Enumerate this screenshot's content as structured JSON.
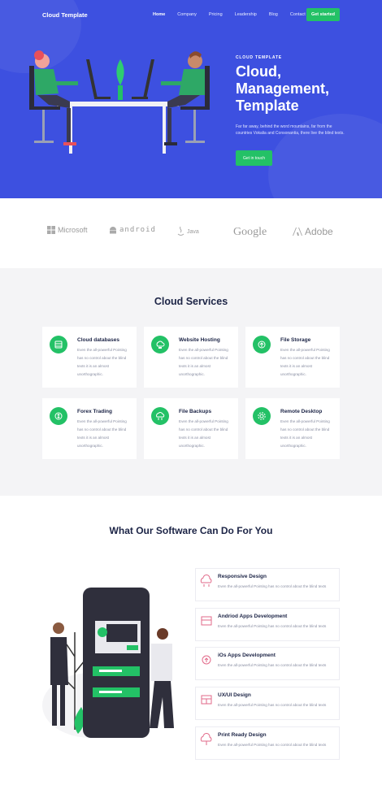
{
  "nav": {
    "logo": "Cloud Template",
    "items": [
      "Home",
      "Company",
      "Pricing",
      "Leadership",
      "Blog",
      "Contact"
    ],
    "cta": "Get started"
  },
  "hero": {
    "kicker": "CLOUD TEMPLATE",
    "title_line1": "Cloud,",
    "title_line2": "Management,",
    "title_line3": "Template",
    "text": "Far far away, behind the word mountains, far from the countries Vokalia and Consonantia, there live the blind texts.",
    "button": "Get in touch"
  },
  "brands": [
    "Microsoft",
    "android",
    "Java",
    "Google",
    "Adobe"
  ],
  "services": {
    "title": "Cloud Services",
    "desc": "Even the all-powerful Pointing has no control about the blind texts it is an almost unorthographic.",
    "items": [
      {
        "title": "Cloud databases",
        "icon": "database-icon"
      },
      {
        "title": "Website Hosting",
        "icon": "hosting-icon"
      },
      {
        "title": "File Storage",
        "icon": "storage-icon"
      },
      {
        "title": "Forex Trading",
        "icon": "trading-icon"
      },
      {
        "title": "File Backups",
        "icon": "backup-icon"
      },
      {
        "title": "Remote Desktop",
        "icon": "gear-icon"
      }
    ]
  },
  "features": {
    "title": "What Our Software Can Do For You",
    "desc": "Even the all-powerful Pointing has no control about the blind texts",
    "items": [
      {
        "title": "Responsive Design"
      },
      {
        "title": "Andriod Apps Development"
      },
      {
        "title": "iOs Apps Development"
      },
      {
        "title": "UX/UI Design"
      },
      {
        "title": "Print Ready Design"
      }
    ]
  },
  "colors": {
    "brand_blue": "#3d50e0",
    "accent_green": "#23c166",
    "feature_icon": "#e26a8a"
  }
}
